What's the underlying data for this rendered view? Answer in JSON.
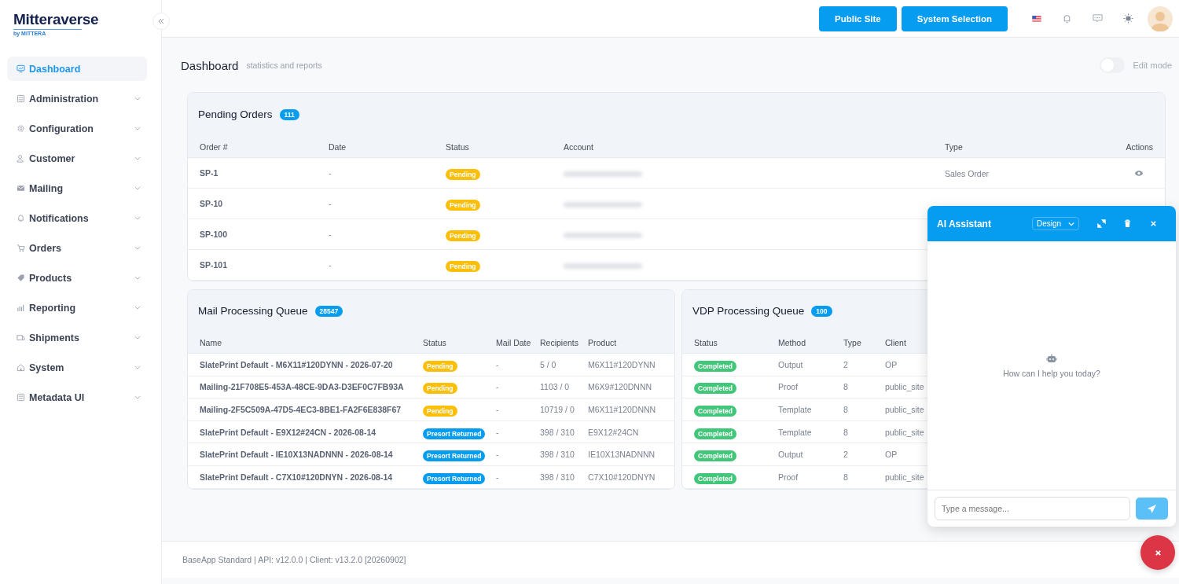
{
  "brand": {
    "name": "Mitteraverse",
    "tagline": "by MITTERA"
  },
  "sidebar": {
    "items": [
      {
        "label": "Dashboard",
        "selected": true,
        "chevron": false
      },
      {
        "label": "Administration",
        "selected": false,
        "chevron": true
      },
      {
        "label": "Configuration",
        "selected": false,
        "chevron": true
      },
      {
        "label": "Customer",
        "selected": false,
        "chevron": true
      },
      {
        "label": "Mailing",
        "selected": false,
        "chevron": true
      },
      {
        "label": "Notifications",
        "selected": false,
        "chevron": true
      },
      {
        "label": "Orders",
        "selected": false,
        "chevron": true
      },
      {
        "label": "Products",
        "selected": false,
        "chevron": true
      },
      {
        "label": "Reporting",
        "selected": false,
        "chevron": true
      },
      {
        "label": "Shipments",
        "selected": false,
        "chevron": true
      },
      {
        "label": "System",
        "selected": false,
        "chevron": true
      },
      {
        "label": "Metadata UI",
        "selected": false,
        "chevron": true
      }
    ]
  },
  "topbar": {
    "buttons": [
      "Public Site",
      "System Selection"
    ]
  },
  "page": {
    "title": "Dashboard",
    "subtitle": "statistics and reports",
    "edit_mode": {
      "label": "Edit mode",
      "on": false
    }
  },
  "pending_orders": {
    "title": "Pending Orders",
    "count": "111",
    "columns": [
      "Order #",
      "Date",
      "Status",
      "Account",
      "Type",
      "Actions"
    ],
    "rows": [
      {
        "order": "SP-1",
        "date": "-",
        "status": {
          "label": "Pending",
          "kind": "pending"
        },
        "type": "Sales Order",
        "action": true
      },
      {
        "order": "SP-10",
        "date": "-",
        "status": {
          "label": "Pending",
          "kind": "pending"
        }
      },
      {
        "order": "SP-100",
        "date": "-",
        "status": {
          "label": "Pending",
          "kind": "pending"
        }
      },
      {
        "order": "SP-101",
        "date": "-",
        "status": {
          "label": "Pending",
          "kind": "pending"
        }
      }
    ]
  },
  "mail_queue": {
    "title": "Mail Processing Queue",
    "count": "28547",
    "columns": [
      "Name",
      "Status",
      "Mail Date",
      "Recipients",
      "Product"
    ],
    "rows": [
      {
        "name": "SlatePrint Default - M6X11#120DYNN - 2026-07-20",
        "status": {
          "label": "Pending",
          "kind": "pending"
        },
        "mail_date": "-",
        "recipients": "5 / 0",
        "product": "M6X11#120DYNN"
      },
      {
        "name": "Mailing-21F708E5-453A-48CE-9DA3-D3EF0C7FB93A",
        "status": {
          "label": "Pending",
          "kind": "pending"
        },
        "mail_date": "-",
        "recipients": "1103 / 0",
        "product": "M6X9#120DNNN"
      },
      {
        "name": "Mailing-2F5C509A-47D5-4EC3-8BE1-FA2F6E838F67",
        "status": {
          "label": "Pending",
          "kind": "pending"
        },
        "mail_date": "-",
        "recipients": "10719 / 0",
        "product": "M6X11#120DNNN"
      },
      {
        "name": "SlatePrint Default - E9X12#24CN - 2026-08-14",
        "status": {
          "label": "Presort Returned",
          "kind": "presort"
        },
        "mail_date": "-",
        "recipients": "398 / 310",
        "product": "E9X12#24CN"
      },
      {
        "name": "SlatePrint Default - IE10X13NADNNN - 2026-08-14",
        "status": {
          "label": "Presort Returned",
          "kind": "presort"
        },
        "mail_date": "-",
        "recipients": "398 / 310",
        "product": "IE10X13NADNNN"
      },
      {
        "name": "SlatePrint Default - C7X10#120DNYN - 2026-08-14",
        "status": {
          "label": "Presort Returned",
          "kind": "presort"
        },
        "mail_date": "-",
        "recipients": "398 / 310",
        "product": "C7X10#120DNYN"
      }
    ]
  },
  "vdp_queue": {
    "title": "VDP Processing Queue",
    "count": "100",
    "columns": [
      "Status",
      "Method",
      "Type",
      "Client"
    ],
    "rows": [
      {
        "status": {
          "label": "Completed",
          "kind": "completed"
        },
        "method": "Output",
        "type": "2",
        "client": "OP"
      },
      {
        "status": {
          "label": "Completed",
          "kind": "completed"
        },
        "method": "Proof",
        "type": "8",
        "client": "public_site"
      },
      {
        "status": {
          "label": "Completed",
          "kind": "completed"
        },
        "method": "Template",
        "type": "8",
        "client": "public_site"
      },
      {
        "status": {
          "label": "Completed",
          "kind": "completed"
        },
        "method": "Template",
        "type": "8",
        "client": "public_site"
      },
      {
        "status": {
          "label": "Completed",
          "kind": "completed"
        },
        "method": "Output",
        "type": "2",
        "client": "OP"
      },
      {
        "status": {
          "label": "Completed",
          "kind": "completed"
        },
        "method": "Proof",
        "type": "8",
        "client": "public_site"
      }
    ]
  },
  "footer": {
    "text": "BaseApp Standard | API: v12.0.0 | Client: v13.2.0 [20260902]"
  },
  "assistant": {
    "title": "AI Assistant",
    "mode": "Design",
    "empty_message": "How can I help you today?",
    "input": {
      "placeholder": "Type a message..."
    }
  }
}
